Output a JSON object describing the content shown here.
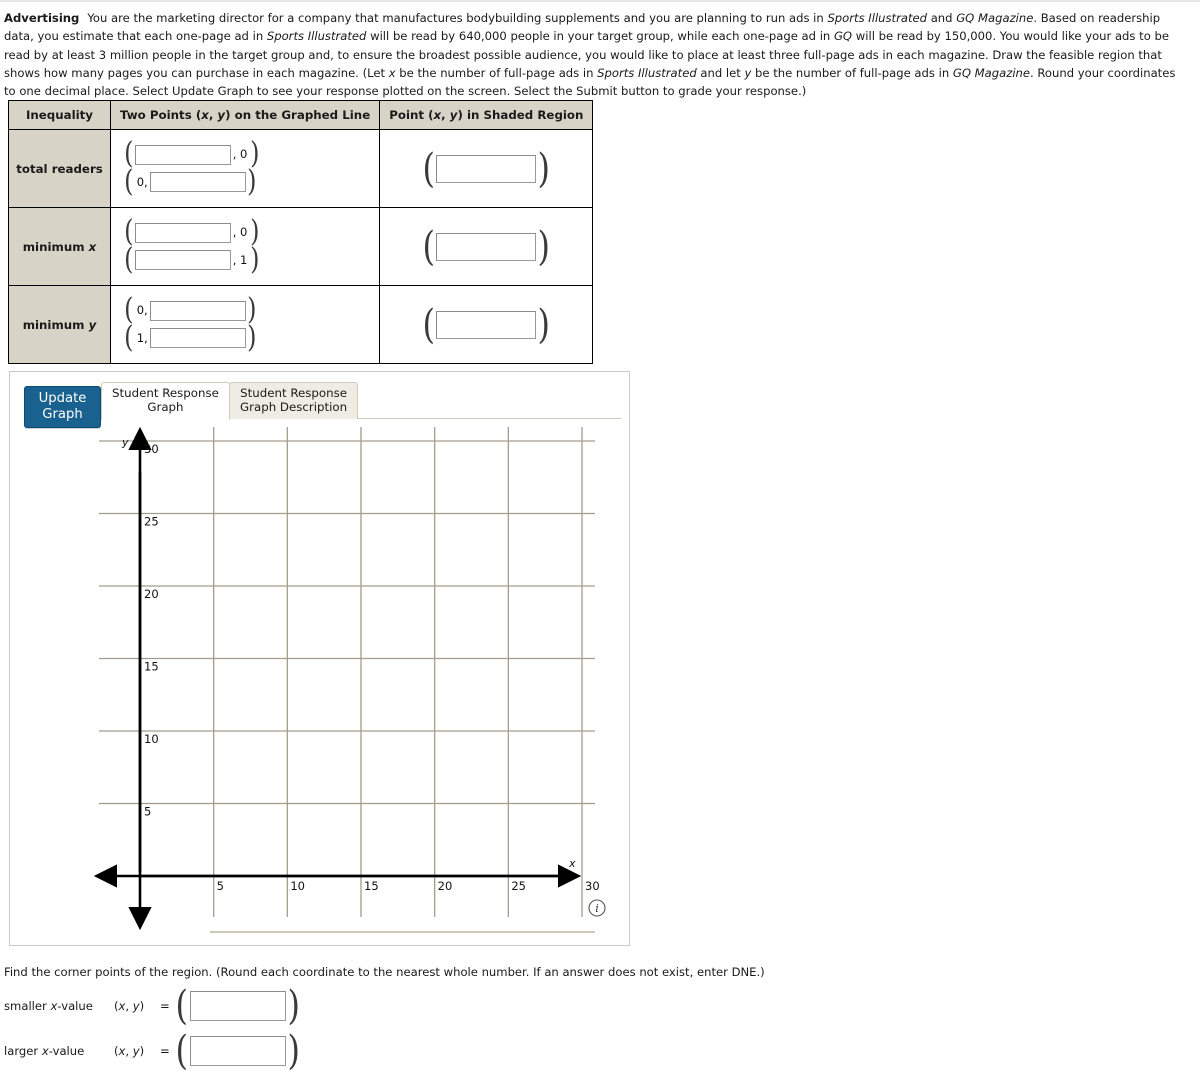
{
  "problem": {
    "topic": "Advertising",
    "paragraph_parts": [
      {
        "t": "You are the marketing director for a company that manufactures bodybuilding supplements and you are planning to run ads in ",
        "style": "normal"
      },
      {
        "t": "Sports Illustrated",
        "style": "italic"
      },
      {
        "t": " and ",
        "style": "normal"
      },
      {
        "t": "GQ Magazine",
        "style": "italic"
      },
      {
        "t": ". Based on readership data, you estimate that each one-page ad in ",
        "style": "normal"
      },
      {
        "t": "Sports Illustrated",
        "style": "italic"
      },
      {
        "t": " will be read by 640,000 people in your target group, while each one-page ad in ",
        "style": "normal"
      },
      {
        "t": "GQ",
        "style": "italic"
      },
      {
        "t": " will be read by 150,000. You would like your ads to be read by at least 3 million people in the target group and, to ensure the broadest possible audience, you would like to place at least three full-page ads in each magazine. Draw the feasible region that shows how many pages you can purchase in each magazine. (Let ",
        "style": "normal"
      },
      {
        "t": "x",
        "style": "italic"
      },
      {
        "t": " be the number of full-page ads in ",
        "style": "normal"
      },
      {
        "t": "Sports Illustrated",
        "style": "italic"
      },
      {
        "t": " and let ",
        "style": "normal"
      },
      {
        "t": "y",
        "style": "italic"
      },
      {
        "t": " be the number of full-page ads in ",
        "style": "normal"
      },
      {
        "t": "GQ Magazine",
        "style": "italic"
      },
      {
        "t": ". Round your coordinates to one decimal place. Select Update Graph to see your response plotted on the screen. Select the Submit button to grade your response.)",
        "style": "normal"
      }
    ]
  },
  "table": {
    "headers": [
      {
        "text": "Inequality"
      },
      {
        "parts": [
          {
            "t": "Two Points (",
            "style": "normal"
          },
          {
            "t": "x",
            "style": "italic"
          },
          {
            "t": ", ",
            "style": "normal"
          },
          {
            "t": "y",
            "style": "italic"
          },
          {
            "t": ") on the Graphed Line",
            "style": "normal"
          }
        ]
      },
      {
        "parts": [
          {
            "t": "Point (",
            "style": "normal"
          },
          {
            "t": "x",
            "style": "italic"
          },
          {
            "t": ", ",
            "style": "normal"
          },
          {
            "t": "y",
            "style": "italic"
          },
          {
            "t": ") in Shaded Region",
            "style": "normal"
          }
        ]
      }
    ],
    "rows": [
      {
        "label_parts": [
          {
            "t": "total readers",
            "style": "normal"
          }
        ],
        "points": [
          {
            "x_input": true,
            "x_value": "",
            "y_input": false,
            "y_fixed": "0"
          },
          {
            "x_input": false,
            "x_fixed": "0",
            "y_input": true,
            "y_value": ""
          }
        ],
        "shaded": {
          "value": ""
        }
      },
      {
        "label_parts": [
          {
            "t": "minimum ",
            "style": "normal"
          },
          {
            "t": "x",
            "style": "italic"
          }
        ],
        "points": [
          {
            "x_input": true,
            "x_value": "",
            "y_input": false,
            "y_fixed": "0"
          },
          {
            "x_input": true,
            "x_value": "",
            "y_input": false,
            "y_fixed": "1"
          }
        ],
        "shaded": {
          "value": ""
        }
      },
      {
        "label_parts": [
          {
            "t": "minimum ",
            "style": "normal"
          },
          {
            "t": "y",
            "style": "italic"
          }
        ],
        "points": [
          {
            "x_input": false,
            "x_fixed": "0",
            "y_input": true,
            "y_value": ""
          },
          {
            "x_input": false,
            "x_fixed": "1",
            "y_input": true,
            "y_value": ""
          }
        ],
        "shaded": {
          "value": ""
        }
      }
    ]
  },
  "graph_panel": {
    "update_button": {
      "line1": "Update",
      "line2": "Graph",
      "color": "#19618f"
    },
    "tabs": [
      {
        "line1": "Student Response",
        "line2": "Graph",
        "active": true
      },
      {
        "line1": "Student Response",
        "line2": "Graph Description",
        "active": false
      }
    ],
    "info_icon_label": "i"
  },
  "chart_data": {
    "type": "scatter",
    "title": "",
    "xlabel": "x",
    "ylabel": "y",
    "xlim": [
      -2,
      30
    ],
    "ylim": [
      -3,
      32
    ],
    "x_ticks": [
      5,
      10,
      15,
      20,
      25,
      30
    ],
    "y_ticks": [
      5,
      10,
      15,
      20,
      25,
      30
    ],
    "x_tick_labels": [
      "5",
      "10",
      "15",
      "20",
      "25",
      "30"
    ],
    "y_tick_labels": [
      "5",
      "10",
      "15",
      "20",
      "25",
      "30"
    ],
    "grid": true,
    "grid_color": "#a39c8c",
    "axis_color": "#000000",
    "series": [],
    "legend": "none",
    "notes": "Empty coordinate grid; no student response plotted yet."
  },
  "bottom": {
    "prompt_parts": [
      {
        "t": "Find the corner points of the region. (Round each coordinate to the nearest whole number. If an answer does not exist, enter DNE.)",
        "style": "normal"
      }
    ],
    "answers": [
      {
        "label_parts": [
          {
            "t": "smaller ",
            "style": "normal"
          },
          {
            "t": "x",
            "style": "italic"
          },
          {
            "t": "-value",
            "style": "normal"
          }
        ],
        "xy_parts": [
          {
            "t": "(",
            "style": "normal"
          },
          {
            "t": "x",
            "style": "italic"
          },
          {
            "t": ", ",
            "style": "normal"
          },
          {
            "t": "y",
            "style": "italic"
          },
          {
            "t": ")",
            "style": "normal"
          }
        ],
        "equals": "=",
        "value": ""
      },
      {
        "label_parts": [
          {
            "t": "larger ",
            "style": "normal"
          },
          {
            "t": "x",
            "style": "italic"
          },
          {
            "t": "-value",
            "style": "normal"
          }
        ],
        "xy_parts": [
          {
            "t": "(",
            "style": "normal"
          },
          {
            "t": "x",
            "style": "italic"
          },
          {
            "t": ", ",
            "style": "normal"
          },
          {
            "t": "y",
            "style": "italic"
          },
          {
            "t": ")",
            "style": "normal"
          }
        ],
        "equals": "=",
        "value": ""
      }
    ]
  }
}
